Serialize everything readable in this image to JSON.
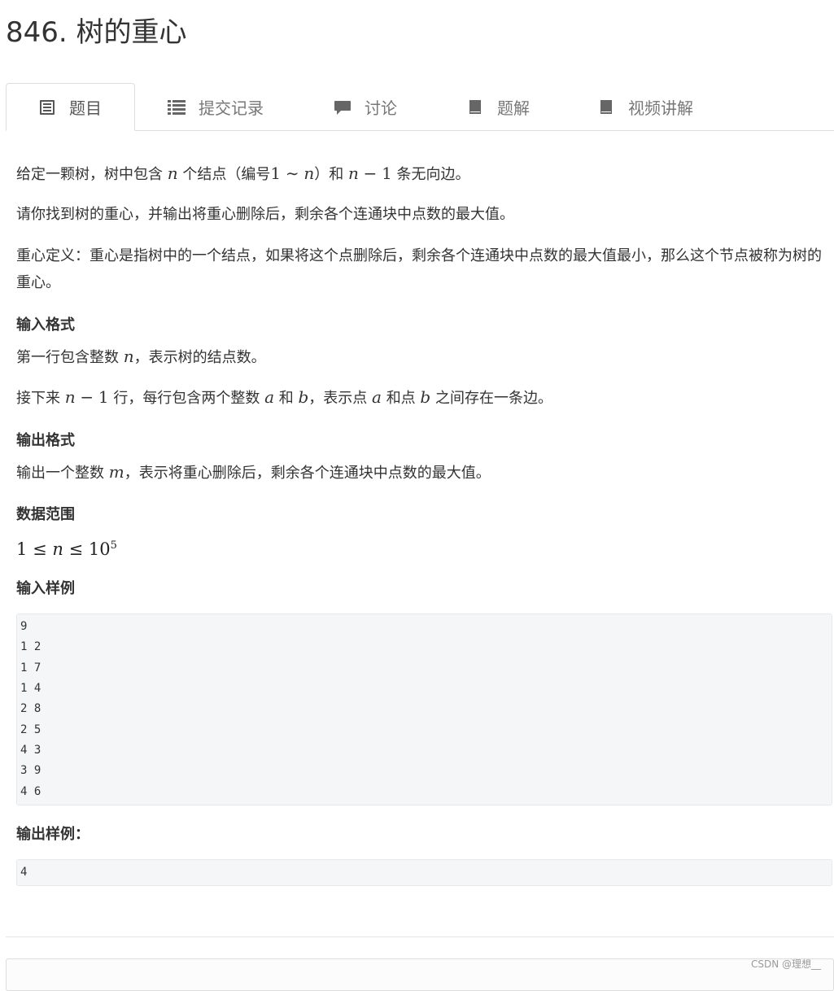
{
  "page": {
    "title": "846. 树的重心"
  },
  "tabs": [
    {
      "label": "题目",
      "icon": "document-icon",
      "active": true
    },
    {
      "label": "提交记录",
      "icon": "list-icon",
      "active": false
    },
    {
      "label": "讨论",
      "icon": "comment-icon",
      "active": false
    },
    {
      "label": "题解",
      "icon": "book-icon",
      "active": false
    },
    {
      "label": "视频讲解",
      "icon": "book-icon",
      "active": false
    }
  ],
  "problem": {
    "intro": {
      "p1": "给定一颗树，树中包含",
      "n": "n",
      "p2": "个结点（编号",
      "range_a": "1",
      "tilde": "∼",
      "range_b": "n",
      "p3": "）和",
      "edges_n": "n",
      "minus": "−",
      "edges_1": "1",
      "p4": "条无向边。"
    },
    "task": "请你找到树的重心，并输出将重心删除后，剩余各个连通块中点数的最大值。",
    "definition": "重心定义：重心是指树中的一个结点，如果将这个点删除后，剩余各个连通块中点数的最大值最小，那么这个节点被称为树的重心。",
    "input_format": {
      "heading": "输入格式",
      "line1_a": "第一行包含整数",
      "line1_n": "n",
      "line1_b": "，表示树的结点数。",
      "line2_a": "接下来",
      "line2_n": "n",
      "line2_minus": "−",
      "line2_1": "1",
      "line2_b": "行，每行包含两个整数",
      "line2_va": "a",
      "line2_c": "和",
      "line2_vb": "b",
      "line2_d": "，表示点",
      "line2_va2": "a",
      "line2_e": "和点",
      "line2_vb2": "b",
      "line2_f": "之间存在一条边。"
    },
    "output_format": {
      "heading": "输出格式",
      "line_a": "输出一个整数",
      "line_m": "m",
      "line_b": "，表示将重心删除后，剩余各个连通块中点数的最大值。"
    },
    "data_range": {
      "heading": "数据范围",
      "low": "1",
      "le1": "≤",
      "var": "n",
      "le2": "≤",
      "base": "10",
      "exp": "5"
    },
    "sample_input": {
      "heading": "输入样例",
      "lines": [
        "9",
        "1 2",
        "1 7",
        "1 4",
        "2 8",
        "2 5",
        "4 3",
        "3 9",
        "4 6"
      ]
    },
    "sample_output": {
      "heading": "输出样例：",
      "lines": [
        "4"
      ]
    }
  },
  "watermark": "CSDN @理想__",
  "colors": {
    "text": "#333333",
    "tab_text": "#777777",
    "border": "#dddddd",
    "code_bg": "#f5f6f7"
  }
}
